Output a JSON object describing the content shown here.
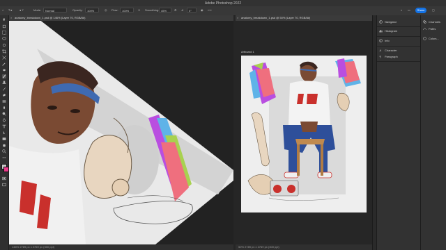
{
  "app": {
    "title": "Adobe Photoshop 2022"
  },
  "options_bar": {
    "mode_label": "Mode:",
    "mode_value": "Normal",
    "opacity_label": "Opacity:",
    "opacity_value": "100%",
    "flow_label": "Flow:",
    "flow_value": "100%",
    "smoothing_label": "Smoothing:",
    "smoothing_value": "45%",
    "angle_value": "0°",
    "share_label": "Share"
  },
  "documents": [
    {
      "tab": "anatomy_breakdown_1.psd @ 146% (Layer 70, RGB/8#)",
      "status": "146%     2789 px x 2769 px (300 ppi)"
    },
    {
      "tab": "anatomy_breakdown_1.psd @ 50% (Layer 70, RGB/8#)",
      "status": "50%     2789 px x 2769 px (300 ppi)",
      "artboard_label": "Artboard 1"
    }
  ],
  "panels": {
    "primary": [
      {
        "label": "Navigator",
        "icon": "compass-icon"
      },
      {
        "label": "Histogram",
        "icon": "histogram-icon"
      },
      {
        "label": "Info",
        "icon": "info-icon"
      },
      {
        "label": "Character",
        "icon": "character-icon"
      },
      {
        "label": "Paragraph",
        "icon": "paragraph-icon"
      }
    ],
    "secondary": [
      {
        "label": "Channels",
        "icon": "channels-icon"
      },
      {
        "label": "Paths",
        "icon": "paths-icon"
      },
      {
        "label": "Colors...",
        "icon": "colors-icon"
      }
    ]
  },
  "colors": {
    "foreground": "#c8c8c8",
    "background": "#e8388a",
    "accent": "#1473e6"
  }
}
